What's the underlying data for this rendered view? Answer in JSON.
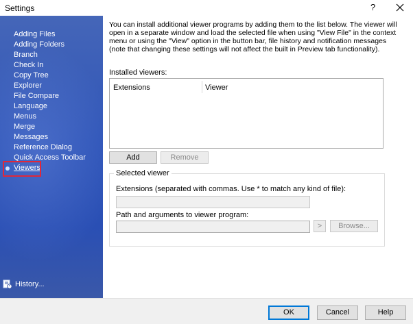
{
  "window": {
    "title": "Settings",
    "help_glyph": "?",
    "close_icon": "close-icon"
  },
  "sidebar": {
    "items": [
      {
        "label": "Adding Files"
      },
      {
        "label": "Adding Folders"
      },
      {
        "label": "Branch"
      },
      {
        "label": "Check In"
      },
      {
        "label": "Copy Tree"
      },
      {
        "label": "Explorer"
      },
      {
        "label": "File Compare"
      },
      {
        "label": "Language"
      },
      {
        "label": "Menus"
      },
      {
        "label": "Merge"
      },
      {
        "label": "Messages"
      },
      {
        "label": "Reference Dialog"
      },
      {
        "label": "Quick Access Toolbar"
      },
      {
        "label": "Viewers",
        "selected": true
      }
    ],
    "history_label": "History...",
    "highlight_color": "#e0283a"
  },
  "main": {
    "intro": "You can install additional viewer programs by adding them to the list below. The viewer will open in a separate window and load the selected file when using \"View File\" in the context menu or using the \"View\" option in the button bar, file history and notification messages (note that changing these settings will not affect the built in Preview tab functionality).",
    "installed_label": "Installed viewers:",
    "columns": [
      "Extensions",
      "Viewer"
    ],
    "add_label": "Add",
    "remove_label": "Remove",
    "selected_viewer": {
      "title": "Selected viewer",
      "extensions_label": "Extensions (separated with commas. Use * to match any kind of file):",
      "extensions_value": "",
      "path_label": "Path and arguments to viewer program:",
      "path_value": "",
      "arrow_label": ">",
      "browse_label": "Browse..."
    }
  },
  "footer": {
    "ok": "OK",
    "cancel": "Cancel",
    "help": "Help"
  }
}
